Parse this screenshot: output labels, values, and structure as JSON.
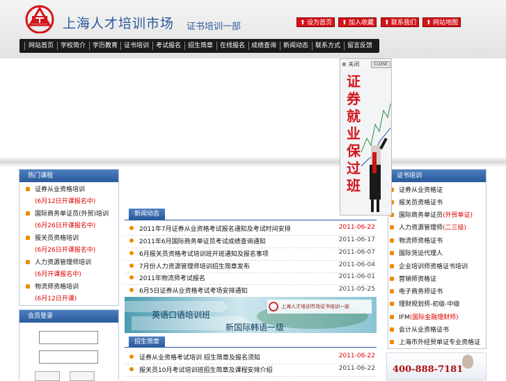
{
  "header": {
    "site_title": "上海人才培训市场",
    "site_subtitle": "证书培训一部",
    "top_buttons": [
      "设为首页",
      "加入收藏",
      "联系我们",
      "网站地图"
    ]
  },
  "nav": {
    "items": [
      "网站首页",
      "学校简介",
      "学历教育",
      "证书培训",
      "考试报名",
      "招生简章",
      "在线报名",
      "成绩查询",
      "新闻动态",
      "联系方式",
      "留言反馈"
    ]
  },
  "left_panel_1": {
    "title": "热门课程",
    "items": [
      {
        "title": "证券从业资格培训",
        "sub": "(6月12日开课报名中)"
      },
      {
        "title": "国际商务单证员(外贸)培训",
        "sub": "(6月26日开课报名中)"
      },
      {
        "title": "报关员资格培训",
        "sub": "(6月26日开课报名中)"
      },
      {
        "title": "人力资源管理师培训",
        "sub": "(6月开课报名中)"
      },
      {
        "title": "物流师资格培训",
        "sub": "(6月12日开课)"
      }
    ]
  },
  "left_panel_2": {
    "title": "会员登录",
    "username_value": "",
    "password_value": "",
    "buttons": [
      "",
      ""
    ]
  },
  "news1": {
    "tab": "新闻动态",
    "rows": [
      {
        "title": "2011年7月证券从业资格考试报名通知及考试时间安排",
        "date": "2011-06-22",
        "highlight": true
      },
      {
        "title": "2011年6月国际商务单证员考试成绩查询通知",
        "date": "2011-06-17",
        "highlight": false
      },
      {
        "title": "6月报关员资格考试培训班开班通知及报名事项",
        "date": "2011-06-07",
        "highlight": false
      },
      {
        "title": "7月份人力资源管理师培训招生简章发布",
        "date": "2011-06-04",
        "highlight": false
      },
      {
        "title": "2011年物流师考试报名",
        "date": "2011-06-01",
        "highlight": false
      },
      {
        "title": "6月5日证券从业资格考试考场安排通知",
        "date": "2011-05-25",
        "highlight": false
      }
    ]
  },
  "banner": {
    "line1": "英语口语培训班",
    "line2": "新国际韩语一级",
    "logo_text": "上海人才培训市场证书培训一部"
  },
  "news2": {
    "tab": "招生简章",
    "rows": [
      {
        "title": "证券从业资格考试培训 招生简章及报名须知",
        "date": "2011-06-22",
        "highlight": true
      },
      {
        "title": "报关员10月考试培训班招生简章及课程安排介绍",
        "date": "2011-06-22",
        "highlight": false
      }
    ]
  },
  "float_ad": {
    "close_label": "关闭",
    "close_en": "CLOSE",
    "text": [
      "证",
      "券",
      "就",
      "业",
      "保",
      "过",
      "班"
    ]
  },
  "right_panel": {
    "title": "证书培训",
    "items": [
      {
        "title": "证券从业资格证",
        "extra": ""
      },
      {
        "title": "报关员资格证书",
        "extra": ""
      },
      {
        "title": "国际商务单证员",
        "extra": "(外贸单证)"
      },
      {
        "title": "人力资源管理师",
        "extra": "(二三级)"
      },
      {
        "title": "物流师资格证书",
        "extra": ""
      },
      {
        "title": "国际货运代理人",
        "extra": ""
      },
      {
        "title": "企业培训师资格证书培训",
        "extra": ""
      },
      {
        "title": "营销师资格证",
        "extra": ""
      },
      {
        "title": "电子商务师证书",
        "extra": ""
      },
      {
        "title": "理财规划师-初级-中级",
        "extra": ""
      },
      {
        "title": "IFM",
        "extra": "(国际金融理财师)"
      },
      {
        "title": "会计从业资格证书",
        "extra": ""
      },
      {
        "title": "上海市外经贸单证专业资格证",
        "extra": ""
      }
    ]
  },
  "hotline": {
    "number": "400-888-7181"
  },
  "colors": {
    "brand_blue": "#2a5a9c",
    "accent_red": "#d3141a",
    "bullet_orange": "#f08a00",
    "nav_black": "#1a1a1a"
  }
}
